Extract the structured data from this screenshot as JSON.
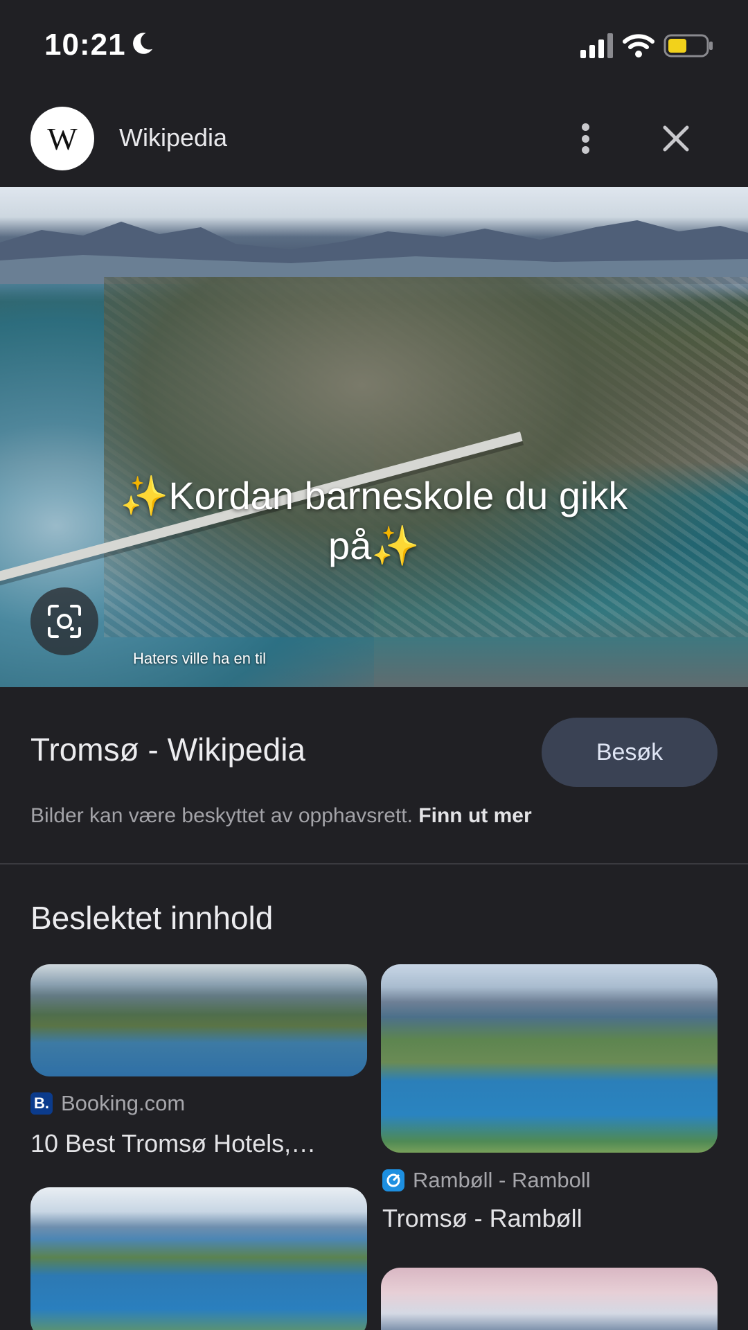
{
  "status_bar": {
    "time": "10:21",
    "icons": [
      "moon-icon",
      "signal-icon",
      "wifi-icon",
      "battery-icon"
    ],
    "battery_color": "#f2d21b"
  },
  "header": {
    "logo_letter": "W",
    "site_name": "Wikipedia"
  },
  "hero": {
    "caption": "✨Kordan barneskole du gikk på✨",
    "subcaption": "Haters ville ha en til"
  },
  "result": {
    "title": "Tromsø - Wikipedia",
    "visit_label": "Besøk",
    "rights_text": "Bilder kan være beskyttet av opphavsrett.",
    "rights_link": "Finn ut mer"
  },
  "related": {
    "heading": "Beslektet innhold",
    "cards": [
      {
        "source": "Booking.com",
        "source_icon": "B.",
        "title": "10 Best Tromsø Hotels,…"
      },
      {
        "source": "Rambøll - Ramboll",
        "source_icon": "ramboll-icon",
        "title": "Tromsø - Rambøll"
      }
    ]
  },
  "colors": {
    "background": "#202024",
    "visit_button": "#3a4254",
    "booking_brand": "#0b3b8c",
    "ramboll_brand": "#1d8fe0"
  }
}
